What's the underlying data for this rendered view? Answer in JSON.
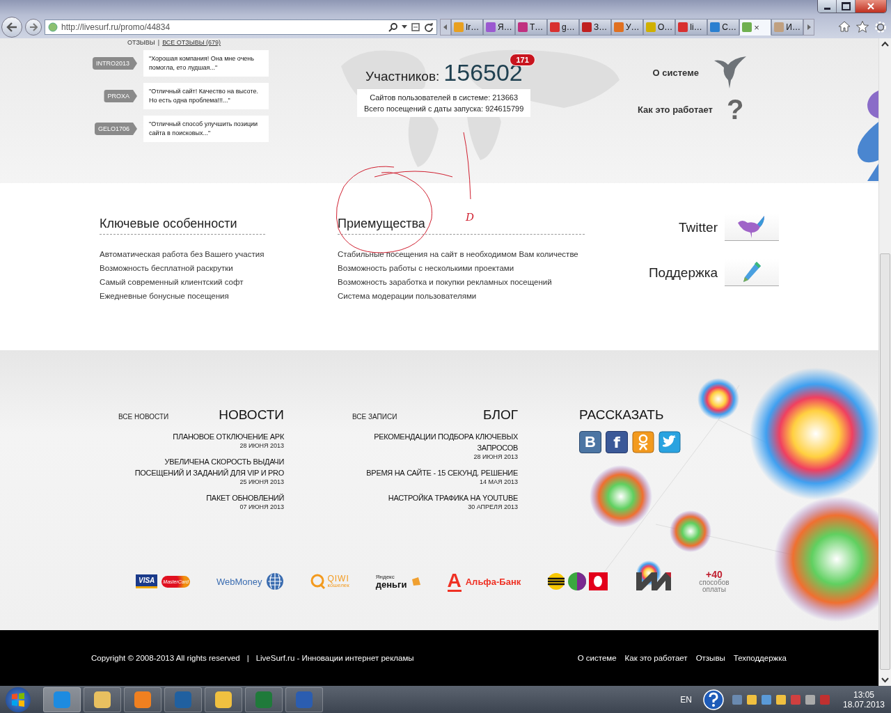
{
  "browser": {
    "url": "http://livesurf.ru/promo/44834",
    "tabs": [
      {
        "label": "Ir…",
        "selected": false
      },
      {
        "label": "Я…",
        "selected": false
      },
      {
        "label": "T…",
        "selected": false
      },
      {
        "label": "g…",
        "selected": false
      },
      {
        "label": "З…",
        "selected": false
      },
      {
        "label": "У…",
        "selected": false
      },
      {
        "label": "O…",
        "selected": false
      },
      {
        "label": "li…",
        "selected": false
      },
      {
        "label": "C…",
        "selected": false
      },
      {
        "selected": true,
        "close": "×"
      },
      {
        "label": "И…",
        "selected": false
      }
    ]
  },
  "reviews": {
    "header": "ОТЗЫВЫ",
    "separator": "|",
    "all_link": "ВСЕ ОТЗЫВЫ (679)",
    "items": [
      {
        "tag": "INTRO2013",
        "quote": "\"Хорошая компания! Она мне очень помогла, ето лудшая...\""
      },
      {
        "tag": "PROXA",
        "quote": "\"Отличный сайт! Качество на высоте. Но есть одна проблема!!!...\""
      },
      {
        "tag": "GELO1706",
        "quote": "\"Отличный способ улучшить позиции сайта в поисковых...\""
      }
    ]
  },
  "stats": {
    "label": "Участников:",
    "count": "156502",
    "badge": "171",
    "lines": [
      "Сайтов пользователей в системе: 213663",
      "Всего посещений с даты запуска: 924615799"
    ]
  },
  "top_links": [
    {
      "kind": "bird",
      "label": "О системе"
    },
    {
      "kind": "question",
      "label": "Как это работает",
      "glyph": "?"
    }
  ],
  "features": [
    {
      "title": "Ключевые особенности",
      "items": [
        "Автоматическая работа без Вашего участия",
        "Возможность бесплатной раскрутки",
        "Самый современный клиентский софт",
        "Ежедневные бонусные посещения"
      ]
    },
    {
      "title": "Приемущества",
      "items": [
        "Стабильные посещения на сайт в необходимом Вам количестве",
        "Возможность работы с несколькими проектами",
        "Возможность заработка и покупки рекламных посещений",
        "Система модерации пользователями"
      ]
    }
  ],
  "side_links": [
    {
      "kind": "twitter",
      "label": "Twitter"
    },
    {
      "kind": "support",
      "label": "Поддержка"
    }
  ],
  "annotation": {
    "mark": "D"
  },
  "news": {
    "all_link": "ВСЕ НОВОСТИ",
    "title": "НОВОСТИ",
    "items": [
      {
        "title": "ПЛАНОВОЕ ОТКЛЮЧЕНИЕ АРК",
        "date": "28 ИЮНЯ 2013"
      },
      {
        "title": "УВЕЛИЧЕНА СКОРОСТЬ ВЫДАЧИ ПОСЕЩЕНИЙ И ЗАДАНИЙ ДЛЯ VIP И PRO",
        "date": "25 ИЮНЯ 2013"
      },
      {
        "title": "ПАКЕТ ОБНОВЛЕНИЙ",
        "date": "07 ИЮНЯ 2013"
      }
    ]
  },
  "blog": {
    "all_link": "ВСЕ ЗАПИСИ",
    "title": "БЛОГ",
    "items": [
      {
        "title": "РЕКОМЕНДАЦИИ ПОДБОРА КЛЮЧЕВЫХ ЗАПРОСОВ",
        "date": "28 ИЮНЯ 2013"
      },
      {
        "title": "ВРЕМЯ НА САЙТЕ - 15 СЕКУНД. РЕШЕНИЕ",
        "date": "14 МАЯ 2013"
      },
      {
        "title": "НАСТРОЙКА ТРАФИКА НА YOUTUBE",
        "date": "30 АПРЕЛЯ 2013"
      }
    ]
  },
  "share": {
    "title": "РАССКАЗАТЬ",
    "buttons": [
      {
        "kind": "vk",
        "glyph": "B"
      },
      {
        "kind": "facebook",
        "glyph": "f"
      },
      {
        "kind": "ok"
      },
      {
        "kind": "twitter"
      }
    ]
  },
  "payments": [
    {
      "kind": "cards",
      "texts": [
        "VISA",
        "MasterCard"
      ]
    },
    {
      "kind": "webmoney",
      "texts": [
        "WebMoney"
      ]
    },
    {
      "kind": "qiwi",
      "texts": [
        "QIWI",
        "кошелек"
      ]
    },
    {
      "kind": "yandex",
      "texts": [
        "Яндекс",
        "деньги"
      ]
    },
    {
      "kind": "alfa",
      "texts": [
        "А",
        "Альфа-Банк"
      ]
    },
    {
      "kind": "mobile"
    },
    {
      "kind": "im"
    },
    {
      "kind": "more",
      "texts": [
        "+40",
        "способов",
        "оплаты"
      ]
    }
  ],
  "footer": {
    "copyright": "Copyright © 2008-2013 All rights reserved",
    "separator": "|",
    "tagline": "LiveSurf.ru - Инновации интернет рекламы",
    "links": [
      "О системе",
      "Как это работает",
      "Отзывы",
      "Техподдержка"
    ]
  },
  "taskbar": {
    "apps": [
      {
        "kind": "ie",
        "selected": true
      },
      {
        "kind": "explorer",
        "selected": false
      },
      {
        "kind": "media",
        "selected": false
      },
      {
        "kind": "hp",
        "selected": false
      },
      {
        "kind": "mail",
        "selected": false
      },
      {
        "kind": "excel",
        "selected": false
      },
      {
        "kind": "word",
        "selected": false
      }
    ],
    "language": "EN",
    "time": "13:05",
    "date": "18.07.2013"
  }
}
